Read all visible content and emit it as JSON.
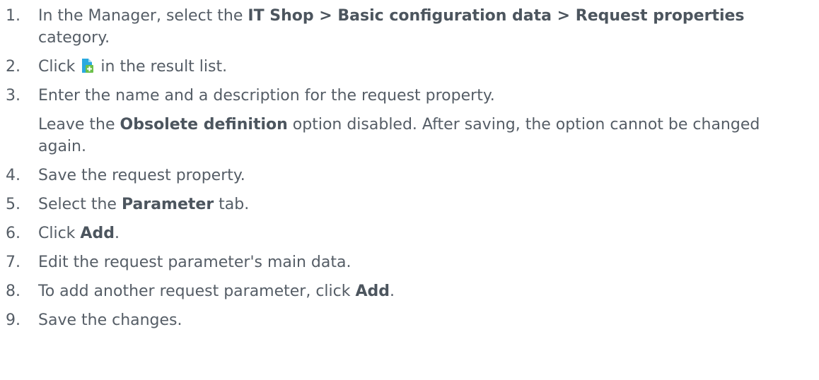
{
  "steps": [
    {
      "number": "1.",
      "parts": [
        "In the Manager, select the ",
        "IT Shop > Basic configuration data > Request properties",
        " category."
      ]
    },
    {
      "number": "2.",
      "parts": [
        "Click ",
        " in the result list."
      ],
      "icon": "add-document-icon",
      "icon_color": "#2aa9e0",
      "icon_plus_color": "#6cc04a"
    },
    {
      "number": "3.",
      "parts": [
        "Enter the name and a description for the request property."
      ],
      "note": [
        "Leave the ",
        "Obsolete definition",
        " option disabled. After saving, the option cannot be changed again."
      ]
    },
    {
      "number": "4.",
      "parts": [
        "Save the request property."
      ]
    },
    {
      "number": "5.",
      "parts": [
        "Select the ",
        "Parameter",
        " tab."
      ]
    },
    {
      "number": "6.",
      "parts": [
        "Click ",
        "Add",
        "."
      ]
    },
    {
      "number": "7.",
      "parts": [
        "Edit the request parameter's main data."
      ]
    },
    {
      "number": "8.",
      "parts": [
        "To add another request parameter, click ",
        "Add",
        "."
      ]
    },
    {
      "number": "9.",
      "parts": [
        "Save the changes."
      ]
    }
  ]
}
